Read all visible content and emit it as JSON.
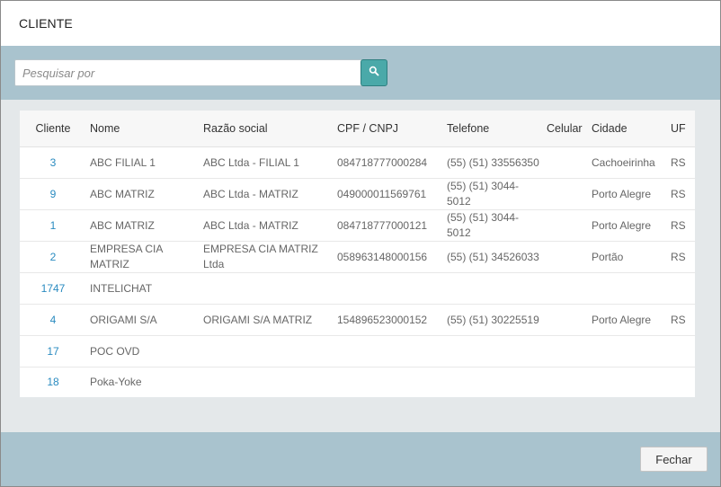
{
  "dialog": {
    "title": "CLIENTE"
  },
  "search": {
    "placeholder": "Pesquisar por",
    "value": ""
  },
  "table": {
    "columns": [
      "Cliente",
      "Nome",
      "Razão social",
      "CPF / CNPJ",
      "Telefone",
      "Celular",
      "Cidade",
      "UF"
    ],
    "rows": [
      {
        "cliente": "3",
        "nome": "ABC FILIAL 1",
        "razao_social": "ABC Ltda - FILIAL 1",
        "cpf_cnpj": "084718777000284",
        "telefone": "(55) (51) 33556350",
        "celular": "",
        "cidade": "Cachoeirinha",
        "uf": "RS"
      },
      {
        "cliente": "9",
        "nome": "ABC MATRIZ",
        "razao_social": "ABC Ltda - MATRIZ",
        "cpf_cnpj": "049000011569761",
        "telefone": "(55) (51) 3044-5012",
        "celular": "",
        "cidade": "Porto Alegre",
        "uf": "RS"
      },
      {
        "cliente": "1",
        "nome": "ABC MATRIZ",
        "razao_social": "ABC Ltda - MATRIZ",
        "cpf_cnpj": "084718777000121",
        "telefone": "(55) (51) 3044-5012",
        "celular": "",
        "cidade": "Porto Alegre",
        "uf": "RS"
      },
      {
        "cliente": "2",
        "nome": "EMPRESA CIA MATRIZ",
        "razao_social": "EMPRESA CIA MATRIZ Ltda",
        "cpf_cnpj": "058963148000156",
        "telefone": "(55) (51) 34526033",
        "celular": "",
        "cidade": "Portão",
        "uf": "RS"
      },
      {
        "cliente": "1747",
        "nome": "INTELICHAT",
        "razao_social": "",
        "cpf_cnpj": "",
        "telefone": "",
        "celular": "",
        "cidade": "",
        "uf": ""
      },
      {
        "cliente": "4",
        "nome": "ORIGAMI S/A",
        "razao_social": "ORIGAMI S/A MATRIZ",
        "cpf_cnpj": "154896523000152",
        "telefone": "(55) (51) 30225519",
        "celular": "",
        "cidade": "Porto Alegre",
        "uf": "RS"
      },
      {
        "cliente": "17",
        "nome": "POC OVD",
        "razao_social": "",
        "cpf_cnpj": "",
        "telefone": "",
        "celular": "",
        "cidade": "",
        "uf": ""
      },
      {
        "cliente": "18",
        "nome": "Poka-Yoke",
        "razao_social": "",
        "cpf_cnpj": "",
        "telefone": "",
        "celular": "",
        "cidade": "",
        "uf": ""
      }
    ]
  },
  "footer": {
    "close_label": "Fechar"
  },
  "icons": {
    "search_button": "search-icon"
  },
  "colors": {
    "band": "#a9c3ce",
    "body_bg": "#e4e8ea",
    "search_button": "#4aa9a9",
    "link": "#2a8bc0"
  }
}
